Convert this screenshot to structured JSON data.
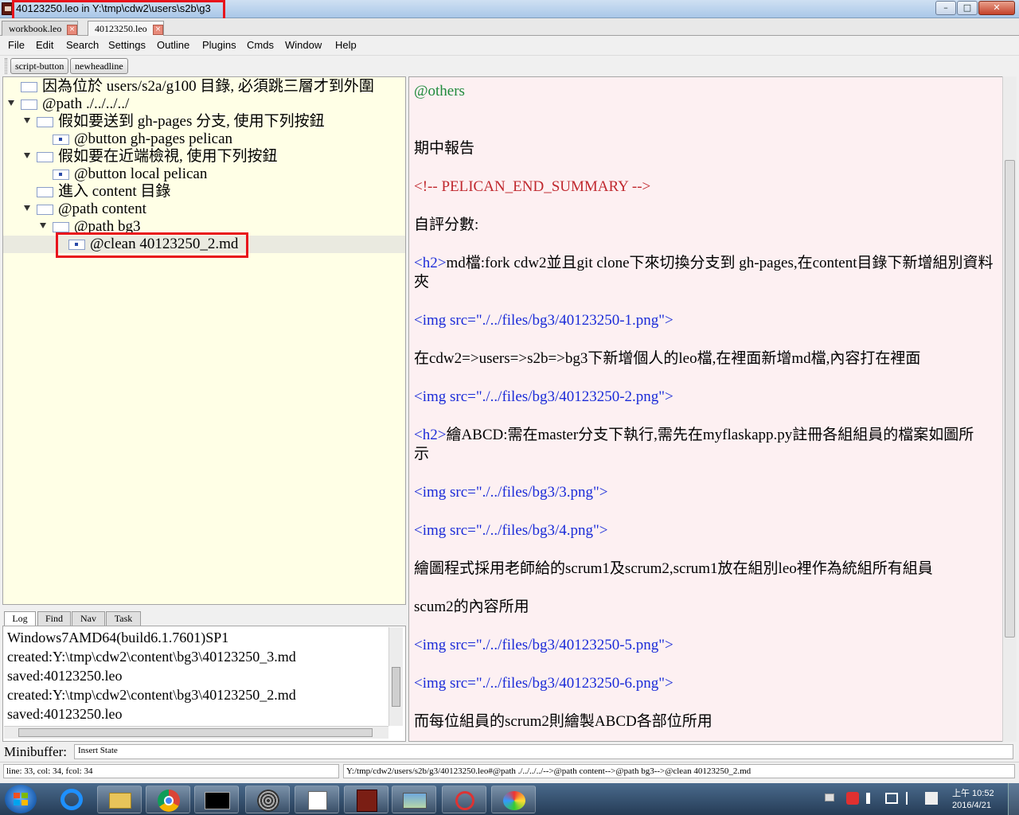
{
  "window": {
    "title": "40123250.leo in Y:\\tmp\\cdw2\\users\\s2b\\g3",
    "minimize": "–",
    "maximize": "□",
    "close": "✕"
  },
  "tabs": [
    {
      "label": "workbook.leo",
      "close": "×"
    },
    {
      "label": "40123250.leo",
      "close": "×"
    }
  ],
  "menu": [
    "File",
    "Edit",
    "Search",
    "Settings",
    "Outline",
    "Plugins",
    "Cmds",
    "Window",
    "Help"
  ],
  "toolbar": {
    "script_button": "script-button",
    "newheadline": "newheadline"
  },
  "outline": [
    {
      "text": "因為位於 users/s2a/g100 目錄, 必須跳三層才到外圍"
    },
    {
      "text": "@path ./../../../"
    },
    {
      "text": "假如要送到 gh-pages 分支, 使用下列按鈕"
    },
    {
      "text": "@button gh-pages pelican"
    },
    {
      "text": "假如要在近端檢視, 使用下列按鈕"
    },
    {
      "text": "@button local pelican"
    },
    {
      "text": "進入 content 目錄"
    },
    {
      "text": "@path content"
    },
    {
      "text": "@path bg3"
    },
    {
      "text": "@clean 40123250_2.md"
    }
  ],
  "log": {
    "tabs": [
      "Log",
      "Find",
      "Nav",
      "Task"
    ],
    "lines": [
      "Windows7AMD64(build6.1.7601)SP1",
      "created:Y:\\tmp\\cdw2\\content\\bg3\\40123250_3.md",
      "saved:40123250.leo",
      "created:Y:\\tmp\\cdw2\\content\\bg3\\40123250_2.md",
      "saved:40123250.leo"
    ]
  },
  "body": {
    "lines": [
      {
        "text": "@others",
        "color": "green"
      },
      {
        "text": "期中報告",
        "color": "black"
      },
      {
        "text": "<!-- PELICAN_END_SUMMARY -->",
        "color": "red"
      },
      {
        "text": "自評分數:",
        "color": "black"
      },
      {
        "prefix": "<h2>",
        "text": "md檔:fork cdw2並且git clone下來切換分支到 gh-pages,在content目錄下新增組別資料"
      },
      {
        "text": "夾",
        "color": "black"
      },
      {
        "text": "<img src=\"./../files/bg3/40123250-1.png\">",
        "color": "blue"
      },
      {
        "text": "在cdw2=>users=>s2b=>bg3下新增個人的leo檔,在裡面新增md檔,內容打在裡面",
        "color": "black"
      },
      {
        "text": "<img src=\"./../files/bg3/40123250-2.png\">",
        "color": "blue"
      },
      {
        "prefix": "<h2>",
        "text": "繪ABCD:需在master分支下執行,需先在myflaskapp.py註冊各組組員的檔案如圖所"
      },
      {
        "text": "示",
        "color": "black"
      },
      {
        "text": "<img src=\"./../files/bg3/3.png\">",
        "color": "blue"
      },
      {
        "text": "<img src=\"./../files/bg3/4.png\">",
        "color": "blue"
      },
      {
        "text": "繪圖程式採用老師給的scrum1及scrum2,scrum1放在組別leo裡作為統組所有組員",
        "color": "black"
      },
      {
        "text": "scum2的內容所用",
        "color": "black"
      },
      {
        "text": "<img src=\"./../files/bg3/40123250-5.png\">",
        "color": "blue"
      },
      {
        "text": "<img src=\"./../files/bg3/40123250-6.png\">",
        "color": "blue"
      },
      {
        "text": "而每位組員的scrum2則繪製ABCD各部位所用",
        "color": "black"
      }
    ]
  },
  "minibuffer": {
    "label": "Minibuffer:",
    "state": "Insert State"
  },
  "status": {
    "position": "line: 33, col: 34, fcol: 34",
    "path": "Y:/tmp/cdw2/users/s2b/g3/40123250.leo#@path ./../../../-->@path content-->@path bg3-->@clean 40123250_2.md"
  },
  "taskbar": {
    "time": "上午 10:52",
    "date": "2016/4/21",
    "apps": [
      "start",
      "internet-explorer",
      "file-explorer",
      "chrome",
      "command-prompt",
      "sphere-app",
      "notepad",
      "leo-editor",
      "image-viewer",
      "snipping-tool",
      "paint"
    ]
  }
}
